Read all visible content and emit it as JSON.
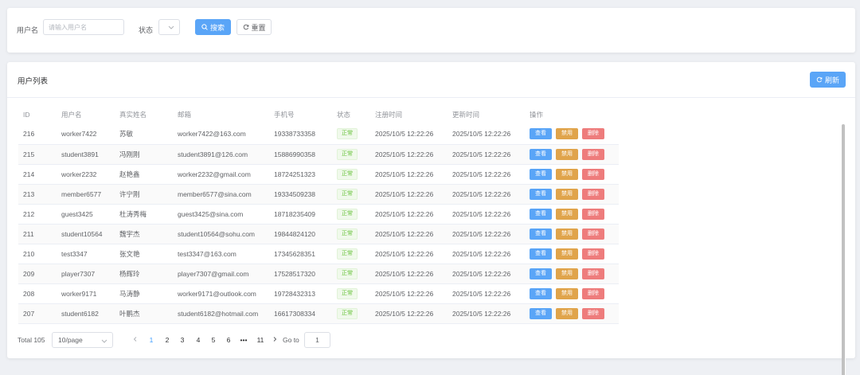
{
  "search": {
    "username_label": "用户名",
    "username_placeholder": "请输入用户名",
    "username_value": "",
    "status_label": "状态",
    "status_value": "",
    "search_button": "搜索",
    "reset_button": "重置"
  },
  "list": {
    "title": "用户列表",
    "refresh_button": "刷新",
    "columns": [
      "ID",
      "用户名",
      "真实姓名",
      "邮箱",
      "手机号",
      "状态",
      "注册时间",
      "更新时间",
      "操作"
    ],
    "actions": {
      "view": "查看",
      "ban": "禁用",
      "delete": "删除"
    },
    "rows": [
      {
        "id": "216",
        "username": "worker7422",
        "real_name": "苏敏",
        "email": "worker7422@163.com",
        "phone": "19338733358",
        "status": "正常",
        "registered": "2025/10/5 12:22:26",
        "updated": "2025/10/5 12:22:26"
      },
      {
        "id": "215",
        "username": "student3891",
        "real_name": "冯刚刚",
        "email": "student3891@126.com",
        "phone": "15886990358",
        "status": "正常",
        "registered": "2025/10/5 12:22:26",
        "updated": "2025/10/5 12:22:26"
      },
      {
        "id": "214",
        "username": "worker2232",
        "real_name": "赵艳鑫",
        "email": "worker2232@gmail.com",
        "phone": "18724251323",
        "status": "正常",
        "registered": "2025/10/5 12:22:26",
        "updated": "2025/10/5 12:22:26"
      },
      {
        "id": "213",
        "username": "member6577",
        "real_name": "许宁刚",
        "email": "member6577@sina.com",
        "phone": "19334509238",
        "status": "正常",
        "registered": "2025/10/5 12:22:26",
        "updated": "2025/10/5 12:22:26"
      },
      {
        "id": "212",
        "username": "guest3425",
        "real_name": "杜涛秀梅",
        "email": "guest3425@sina.com",
        "phone": "18718235409",
        "status": "正常",
        "registered": "2025/10/5 12:22:26",
        "updated": "2025/10/5 12:22:26"
      },
      {
        "id": "211",
        "username": "student10564",
        "real_name": "魏宇杰",
        "email": "student10564@sohu.com",
        "phone": "19844824120",
        "status": "正常",
        "registered": "2025/10/5 12:22:26",
        "updated": "2025/10/5 12:22:26"
      },
      {
        "id": "210",
        "username": "test3347",
        "real_name": "张文艳",
        "email": "test3347@163.com",
        "phone": "17345628351",
        "status": "正常",
        "registered": "2025/10/5 12:22:26",
        "updated": "2025/10/5 12:22:26"
      },
      {
        "id": "209",
        "username": "player7307",
        "real_name": "杨辉玲",
        "email": "player7307@gmail.com",
        "phone": "17528517320",
        "status": "正常",
        "registered": "2025/10/5 12:22:26",
        "updated": "2025/10/5 12:22:26"
      },
      {
        "id": "208",
        "username": "worker9171",
        "real_name": "马涛静",
        "email": "worker9171@outlook.com",
        "phone": "19728432313",
        "status": "正常",
        "registered": "2025/10/5 12:22:26",
        "updated": "2025/10/5 12:22:26"
      },
      {
        "id": "207",
        "username": "student6182",
        "real_name": "叶鹏杰",
        "email": "student6182@hotmail.com",
        "phone": "16617308334",
        "status": "正常",
        "registered": "2025/10/5 12:22:26",
        "updated": "2025/10/5 12:22:26"
      }
    ]
  },
  "pagination": {
    "total": "Total 105",
    "page_size": "10/page",
    "pages": [
      "1",
      "2",
      "3",
      "4",
      "5",
      "6",
      "•••",
      "11"
    ],
    "current": "1",
    "goto_label": "Go to",
    "goto_value": "1"
  },
  "colors": {
    "primary": "#5aa5f7",
    "warning": "#e0a44b",
    "danger": "#ee7c7c",
    "success_tag": "#67c23a"
  }
}
